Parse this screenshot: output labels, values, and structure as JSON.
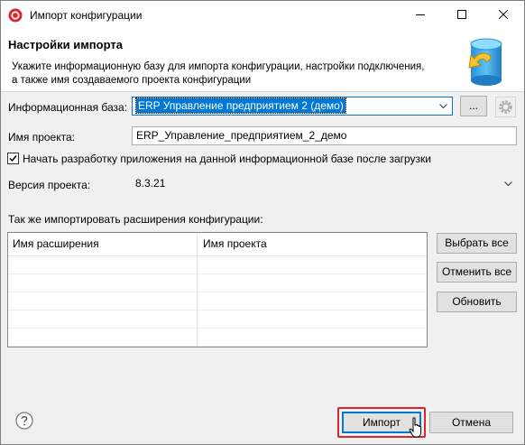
{
  "window": {
    "title": "Импорт конфигурации"
  },
  "banner": {
    "title": "Настройки импорта",
    "description_line1": "Укажите информационную базу для импорта конфигурации, настройки подключения,",
    "description_line2": "а также имя создаваемого проекта конфигурации"
  },
  "form": {
    "infobase_label": "Информационная база:",
    "infobase_value": "ERP Управление предприятием 2 (демо)",
    "browse_label": "...",
    "project_name_label": "Имя проекта:",
    "project_name_value": "ERP_Управление_предприятием_2_демо",
    "start_dev_checkbox_label": "Начать разработку приложения на данной информационной базе после загрузки",
    "start_dev_checked": true,
    "project_version_label": "Версия проекта:",
    "project_version_value": "8.3.21"
  },
  "extensions": {
    "section_label": "Так же импортировать расширения конфигурации:",
    "columns": [
      "Имя расширения",
      "Имя проекта"
    ],
    "rows": [],
    "select_all_label": "Выбрать все",
    "deselect_all_label": "Отменить все",
    "refresh_label": "Обновить"
  },
  "footer": {
    "import_label": "Импорт",
    "cancel_label": "Отмена"
  },
  "colors": {
    "accent": "#0078d7",
    "highlight": "#d9252c"
  },
  "icons": {
    "app": "1c-logo-icon",
    "banner": "database-import-icon",
    "help": "help-icon",
    "gear": "gear-icon"
  }
}
